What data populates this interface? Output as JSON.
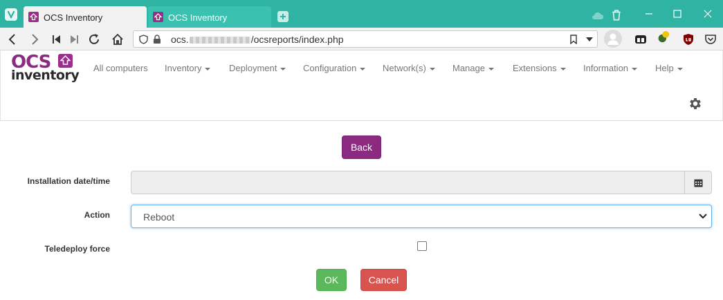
{
  "browser": {
    "tabs": [
      {
        "label": "OCS Inventory",
        "active": true
      },
      {
        "label": "OCS Inventory",
        "active": false
      }
    ],
    "url_prefix": "ocs.",
    "url_suffix": "/ocsreports/index.php",
    "colors": {
      "tabbar": "#2fb3a2",
      "favicon": "#9c2d8c"
    }
  },
  "app": {
    "logo": {
      "top": "OCS",
      "bottom": "inventory"
    },
    "menu": [
      {
        "label": "All computers",
        "dropdown": false
      },
      {
        "label": "Inventory",
        "dropdown": true
      },
      {
        "label": "Deployment",
        "dropdown": true
      },
      {
        "label": "Configuration",
        "dropdown": true
      },
      {
        "label": "Network(s)",
        "dropdown": true
      },
      {
        "label": "Manage",
        "dropdown": true
      },
      {
        "label": "Extensions",
        "dropdown": true
      },
      {
        "label": "Information",
        "dropdown": true
      },
      {
        "label": "Help",
        "dropdown": true
      }
    ],
    "brand_color": "#8c2a82"
  },
  "form": {
    "back_label": "Back",
    "date_label": "Installation date/time",
    "date_value": "",
    "action_label": "Action",
    "action_value": "Reboot",
    "force_label": "Teledeploy force",
    "force_checked": false,
    "ok_label": "OK",
    "cancel_label": "Cancel"
  }
}
